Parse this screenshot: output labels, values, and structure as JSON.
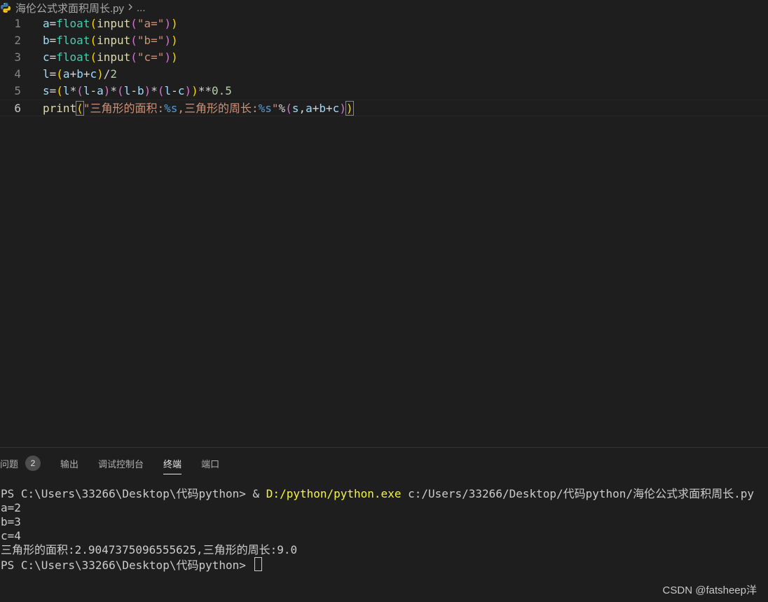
{
  "breadcrumb": {
    "file_icon": "python-icon",
    "file": "海伦公式求面积周长.py",
    "separator": ">",
    "more": "..."
  },
  "editor": {
    "lines": [
      {
        "num": "1",
        "tokens": [
          {
            "t": "a",
            "c": "v"
          },
          {
            "t": "=",
            "c": "p"
          },
          {
            "t": "float",
            "c": "fb"
          },
          {
            "t": "(",
            "c": "b1"
          },
          {
            "t": "input",
            "c": "f"
          },
          {
            "t": "(",
            "c": "b2"
          },
          {
            "t": "\"a=\"",
            "c": "s"
          },
          {
            "t": ")",
            "c": "b2"
          },
          {
            "t": ")",
            "c": "b1"
          }
        ]
      },
      {
        "num": "2",
        "tokens": [
          {
            "t": "b",
            "c": "v"
          },
          {
            "t": "=",
            "c": "p"
          },
          {
            "t": "float",
            "c": "fb"
          },
          {
            "t": "(",
            "c": "b1"
          },
          {
            "t": "input",
            "c": "f"
          },
          {
            "t": "(",
            "c": "b2"
          },
          {
            "t": "\"b=\"",
            "c": "s"
          },
          {
            "t": ")",
            "c": "b2"
          },
          {
            "t": ")",
            "c": "b1"
          }
        ]
      },
      {
        "num": "3",
        "tokens": [
          {
            "t": "c",
            "c": "v"
          },
          {
            "t": "=",
            "c": "p"
          },
          {
            "t": "float",
            "c": "fb"
          },
          {
            "t": "(",
            "c": "b1"
          },
          {
            "t": "input",
            "c": "f"
          },
          {
            "t": "(",
            "c": "b2"
          },
          {
            "t": "\"c=\"",
            "c": "s"
          },
          {
            "t": ")",
            "c": "b2"
          },
          {
            "t": ")",
            "c": "b1"
          }
        ]
      },
      {
        "num": "4",
        "tokens": [
          {
            "t": "l",
            "c": "v"
          },
          {
            "t": "=",
            "c": "p"
          },
          {
            "t": "(",
            "c": "b1"
          },
          {
            "t": "a",
            "c": "v"
          },
          {
            "t": "+",
            "c": "p"
          },
          {
            "t": "b",
            "c": "v"
          },
          {
            "t": "+",
            "c": "p"
          },
          {
            "t": "c",
            "c": "v"
          },
          {
            "t": ")",
            "c": "b1"
          },
          {
            "t": "/",
            "c": "p"
          },
          {
            "t": "2",
            "c": "n"
          }
        ]
      },
      {
        "num": "5",
        "tokens": [
          {
            "t": "s",
            "c": "v"
          },
          {
            "t": "=",
            "c": "p"
          },
          {
            "t": "(",
            "c": "b1"
          },
          {
            "t": "l",
            "c": "v"
          },
          {
            "t": "*",
            "c": "p"
          },
          {
            "t": "(",
            "c": "b2"
          },
          {
            "t": "l",
            "c": "v"
          },
          {
            "t": "-",
            "c": "p"
          },
          {
            "t": "a",
            "c": "v"
          },
          {
            "t": ")",
            "c": "b2"
          },
          {
            "t": "*",
            "c": "p"
          },
          {
            "t": "(",
            "c": "b2"
          },
          {
            "t": "l",
            "c": "v"
          },
          {
            "t": "-",
            "c": "p"
          },
          {
            "t": "b",
            "c": "v"
          },
          {
            "t": ")",
            "c": "b2"
          },
          {
            "t": "*",
            "c": "p"
          },
          {
            "t": "(",
            "c": "b2"
          },
          {
            "t": "l",
            "c": "v"
          },
          {
            "t": "-",
            "c": "p"
          },
          {
            "t": "c",
            "c": "v"
          },
          {
            "t": ")",
            "c": "b2"
          },
          {
            "t": ")",
            "c": "b1"
          },
          {
            "t": "**",
            "c": "p"
          },
          {
            "t": "0.5",
            "c": "n"
          }
        ]
      },
      {
        "num": "6",
        "current": true,
        "tokens": [
          {
            "t": "print",
            "c": "f"
          },
          {
            "t": "(",
            "c": "b1 match"
          },
          {
            "t": "\"三角形的面积:",
            "c": "s"
          },
          {
            "t": "%s",
            "c": "fm"
          },
          {
            "t": ",三角形的周长:",
            "c": "s"
          },
          {
            "t": "%s",
            "c": "fm"
          },
          {
            "t": "\"",
            "c": "s"
          },
          {
            "t": "%",
            "c": "p"
          },
          {
            "t": "(",
            "c": "b2"
          },
          {
            "t": "s",
            "c": "v"
          },
          {
            "t": ",",
            "c": "p"
          },
          {
            "t": "a",
            "c": "v"
          },
          {
            "t": "+",
            "c": "p"
          },
          {
            "t": "b",
            "c": "v"
          },
          {
            "t": "+",
            "c": "p"
          },
          {
            "t": "c",
            "c": "v"
          },
          {
            "t": ")",
            "c": "b2"
          },
          {
            "t": ")",
            "c": "b1 match"
          }
        ]
      }
    ]
  },
  "panel": {
    "tabs": [
      {
        "label": "问题",
        "badge": "2",
        "active": false,
        "name": "tab-problems"
      },
      {
        "label": "输出",
        "active": false,
        "name": "tab-output"
      },
      {
        "label": "调试控制台",
        "active": false,
        "name": "tab-debug-console"
      },
      {
        "label": "终端",
        "active": true,
        "name": "tab-terminal"
      },
      {
        "label": "端口",
        "active": false,
        "name": "tab-ports"
      }
    ]
  },
  "terminal": {
    "prompt": "PS C:\\Users\\33266\\Desktop\\代码python> ",
    "command_amp": "& ",
    "command_exe": "D:/python/python.exe",
    "command_arg": " c:/Users/33266/Desktop/代码python/海伦公式求面积周长.py",
    "output": [
      "a=2",
      "b=3",
      "c=4",
      "三角形的面积:2.9047375096555625,三角形的周长:9.0"
    ],
    "final_prompt": "PS C:\\Users\\33266\\Desktop\\代码python> "
  },
  "watermark": "CSDN @fatsheep洋"
}
